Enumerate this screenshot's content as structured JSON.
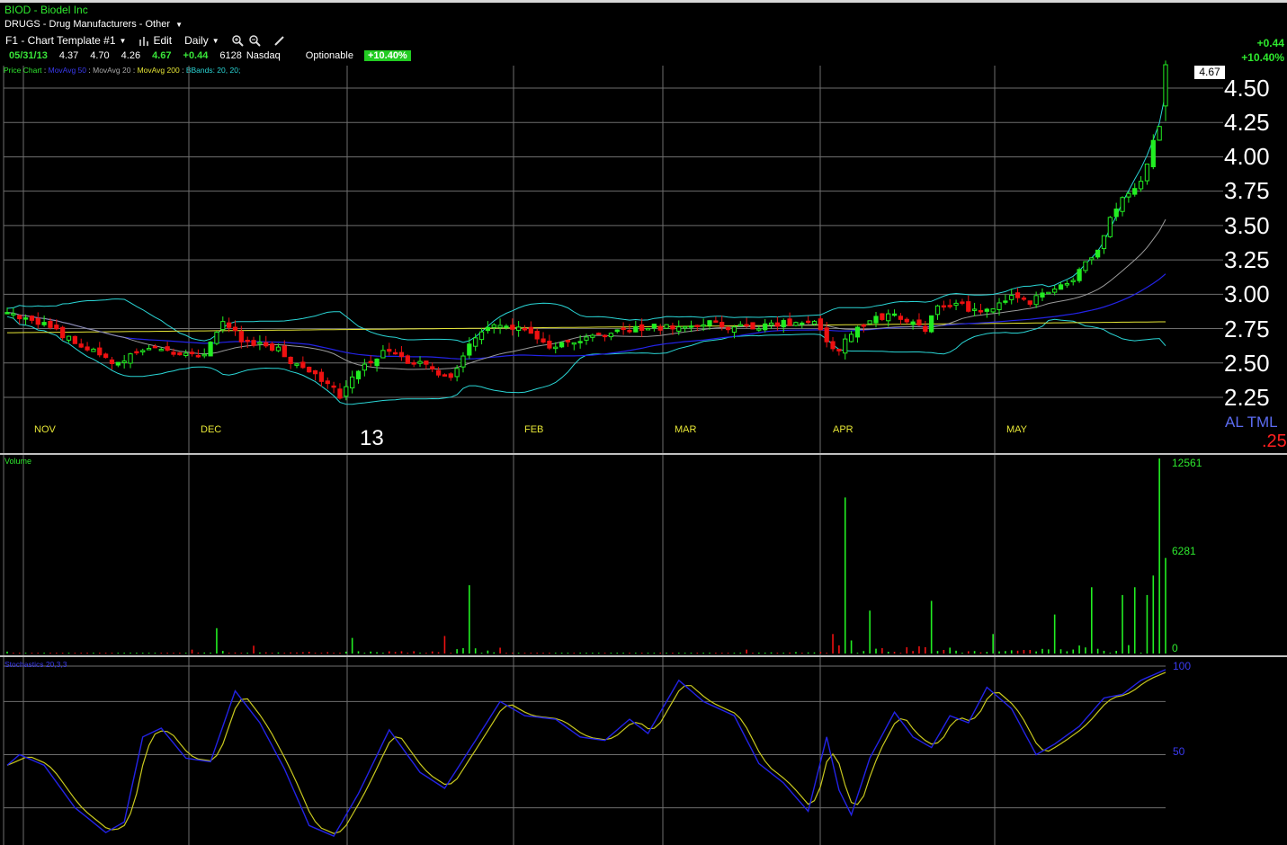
{
  "header": {
    "symbol_title": "BIOD - Biodel Inc",
    "sector": "DRUGS - Drug Manufacturers - Other"
  },
  "toolbar": {
    "template": "F1 - Chart Template #1",
    "edit": "Edit",
    "period": "Daily"
  },
  "quote": {
    "date": "05/31/13",
    "open": "4.37",
    "high": "4.70",
    "low": "4.26",
    "last": "4.67",
    "change": "+0.44",
    "volume": "6128",
    "exchange": "Nasdaq",
    "optionable": "Optionable",
    "pct_change": "+10.40%"
  },
  "right_change": {
    "abs": "+0.44",
    "pct": "+10.40%"
  },
  "legend": {
    "price": "Price Chart",
    "ma50": "MovAvg 50",
    "ma20": "MovAvg 20",
    "ma200": "MovAvg 200",
    "bbands": "BBands: 20, 20;"
  },
  "current_price_tag": "4.67",
  "colors": {
    "up": "#22ee22",
    "down": "#ee1111",
    "ma50": "#2323e6",
    "ma20": "#9a9a9a",
    "ma200": "#e6e636",
    "bbands": "#2ad6d6",
    "stoch_k": "#2323e6",
    "stoch_d": "#c8c81e"
  },
  "price_axis": {
    "ticks": [
      "4.50",
      "4.25",
      "4.00",
      "3.75",
      "3.50",
      "3.25",
      "3.00",
      "2.75",
      "2.50",
      "2.25"
    ],
    "overlay_text": "AL TML",
    "overlay_text2": ".25"
  },
  "time_axis": {
    "months": [
      "NOV",
      "DEC",
      "FEB",
      "MAR",
      "APR",
      "MAY"
    ],
    "year": "13"
  },
  "volume_panel": {
    "label": "Volume",
    "ticks": [
      "12561",
      "6281",
      "0"
    ]
  },
  "stochastics_panel": {
    "label": "Stochastics 20,3,3",
    "ticks": [
      "100",
      "50"
    ]
  },
  "chart_data": {
    "type": "line",
    "title": "BIOD - Biodel Inc",
    "period": "Daily",
    "ylim": [
      2.25,
      4.6
    ],
    "y_ticks": [
      4.5,
      4.25,
      4.0,
      3.75,
      3.5,
      3.25,
      3.0,
      2.75,
      2.5,
      2.25
    ],
    "x_months": [
      "NOV",
      "DEC",
      "13",
      "FEB",
      "MAR",
      "APR",
      "MAY"
    ],
    "price_anchors": [
      [
        0,
        2.86
      ],
      [
        6,
        2.78
      ],
      [
        12,
        2.63
      ],
      [
        16,
        2.53
      ],
      [
        18,
        2.5
      ],
      [
        20,
        2.55
      ],
      [
        23,
        2.62
      ],
      [
        27,
        2.57
      ],
      [
        32,
        2.54
      ],
      [
        35,
        2.82
      ],
      [
        38,
        2.67
      ],
      [
        44,
        2.6
      ],
      [
        47,
        2.48
      ],
      [
        52,
        2.36
      ],
      [
        54,
        2.25
      ],
      [
        57,
        2.44
      ],
      [
        61,
        2.58
      ],
      [
        65,
        2.52
      ],
      [
        68,
        2.48
      ],
      [
        72,
        2.38
      ],
      [
        74,
        2.57
      ],
      [
        76,
        2.68
      ],
      [
        79,
        2.78
      ],
      [
        84,
        2.73
      ],
      [
        88,
        2.62
      ],
      [
        92,
        2.66
      ],
      [
        96,
        2.7
      ],
      [
        100,
        2.74
      ],
      [
        104,
        2.76
      ],
      [
        110,
        2.77
      ],
      [
        114,
        2.79
      ],
      [
        117,
        2.76
      ],
      [
        121,
        2.76
      ],
      [
        128,
        2.8
      ],
      [
        131,
        2.78
      ],
      [
        133,
        2.66
      ],
      [
        135,
        2.59
      ],
      [
        138,
        2.78
      ],
      [
        142,
        2.83
      ],
      [
        144,
        2.86
      ],
      [
        146,
        2.8
      ],
      [
        149,
        2.75
      ],
      [
        151,
        2.9
      ],
      [
        155,
        2.92
      ],
      [
        158,
        2.86
      ],
      [
        163,
        2.98
      ],
      [
        166,
        2.94
      ],
      [
        168,
        3.0
      ],
      [
        171,
        3.05
      ],
      [
        173,
        3.1
      ],
      [
        175,
        3.22
      ],
      [
        177,
        3.34
      ],
      [
        179,
        3.55
      ],
      [
        181,
        3.7
      ],
      [
        183,
        3.75
      ],
      [
        184,
        3.84
      ],
      [
        186,
        4.1
      ],
      [
        187,
        4.23
      ],
      [
        188,
        4.67
      ]
    ],
    "volume_anchors": [
      [
        0,
        0.01
      ],
      [
        30,
        0.02
      ],
      [
        34,
        0.13
      ],
      [
        40,
        0.04
      ],
      [
        56,
        0.08
      ],
      [
        71,
        0.09
      ],
      [
        75,
        0.35
      ],
      [
        80,
        0.03
      ],
      [
        120,
        0.02
      ],
      [
        134,
        0.1
      ],
      [
        136,
        0.8
      ],
      [
        140,
        0.22
      ],
      [
        150,
        0.27
      ],
      [
        160,
        0.1
      ],
      [
        170,
        0.2
      ],
      [
        176,
        0.34
      ],
      [
        181,
        0.3
      ],
      [
        183,
        0.34
      ],
      [
        185,
        0.3
      ],
      [
        186,
        0.4
      ],
      [
        187,
        1.0
      ],
      [
        188,
        0.49
      ]
    ],
    "stoch_k_anchors": [
      [
        0,
        44
      ],
      [
        2,
        50
      ],
      [
        6,
        44
      ],
      [
        11,
        20
      ],
      [
        16,
        6
      ],
      [
        19,
        12
      ],
      [
        22,
        60
      ],
      [
        25,
        65
      ],
      [
        29,
        48
      ],
      [
        33,
        46
      ],
      [
        37,
        86
      ],
      [
        41,
        68
      ],
      [
        45,
        42
      ],
      [
        49,
        10
      ],
      [
        53,
        4
      ],
      [
        57,
        28
      ],
      [
        62,
        64
      ],
      [
        67,
        40
      ],
      [
        71,
        31
      ],
      [
        76,
        58
      ],
      [
        80,
        80
      ],
      [
        84,
        72
      ],
      [
        89,
        70
      ],
      [
        93,
        60
      ],
      [
        97,
        58
      ],
      [
        101,
        70
      ],
      [
        104,
        62
      ],
      [
        109,
        92
      ],
      [
        113,
        80
      ],
      [
        118,
        72
      ],
      [
        122,
        45
      ],
      [
        126,
        34
      ],
      [
        130,
        18
      ],
      [
        133,
        60
      ],
      [
        135,
        30
      ],
      [
        137,
        16
      ],
      [
        140,
        48
      ],
      [
        144,
        74
      ],
      [
        147,
        60
      ],
      [
        150,
        54
      ],
      [
        153,
        72
      ],
      [
        156,
        68
      ],
      [
        159,
        88
      ],
      [
        163,
        76
      ],
      [
        167,
        50
      ],
      [
        170,
        56
      ],
      [
        174,
        66
      ],
      [
        178,
        82
      ],
      [
        181,
        84
      ],
      [
        184,
        92
      ],
      [
        188,
        98
      ]
    ],
    "series": [
      {
        "name": "Price Chart",
        "kind": "candlestick"
      },
      {
        "name": "MovAvg 50",
        "kind": "line"
      },
      {
        "name": "MovAvg 20",
        "kind": "line"
      },
      {
        "name": "MovAvg 200",
        "kind": "line"
      },
      {
        "name": "BBands: 20, 20;",
        "kind": "band"
      },
      {
        "name": "Volume",
        "kind": "bar",
        "ylim": [
          0,
          12561
        ]
      },
      {
        "name": "Stochastics 20,3,3",
        "kind": "line",
        "ylim": [
          0,
          100
        ]
      }
    ]
  }
}
